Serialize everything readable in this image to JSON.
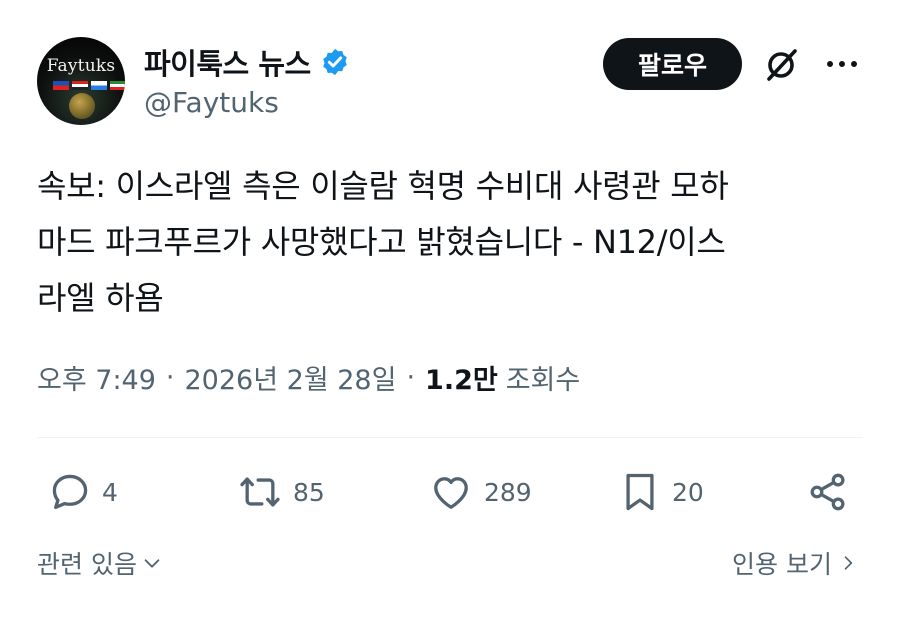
{
  "author": {
    "avatar_text": "Faytuks",
    "display_name": "파이툭스 뉴스",
    "handle": "@Faytuks",
    "verified_icon": "verified-badge-icon"
  },
  "header": {
    "follow_label": "팔로우",
    "grok_icon": "grok-icon",
    "more_icon": "more-options-icon"
  },
  "tweet": {
    "text_lines": [
      "속보: 이스라엘 측은 이슬람 혁명 수비대 사령관 모하",
      "마드 파크푸르가 사망했다고 밝혔습니다 - N12/이스",
      "라엘 하욤"
    ]
  },
  "meta": {
    "time": "오후 7:49",
    "date": "2026년 2월 28일",
    "views_count": "1.2만",
    "views_label": "조회수"
  },
  "actions": {
    "replies": "4",
    "retweets": "85",
    "likes": "289",
    "bookmarks": "20"
  },
  "footer": {
    "related_label": "관련 있음",
    "quotes_label": "인용 보기"
  },
  "colors": {
    "accent": "#1d9bf0",
    "text": "#0f1419",
    "secondary": "#536471",
    "divider": "#eff3f4"
  }
}
